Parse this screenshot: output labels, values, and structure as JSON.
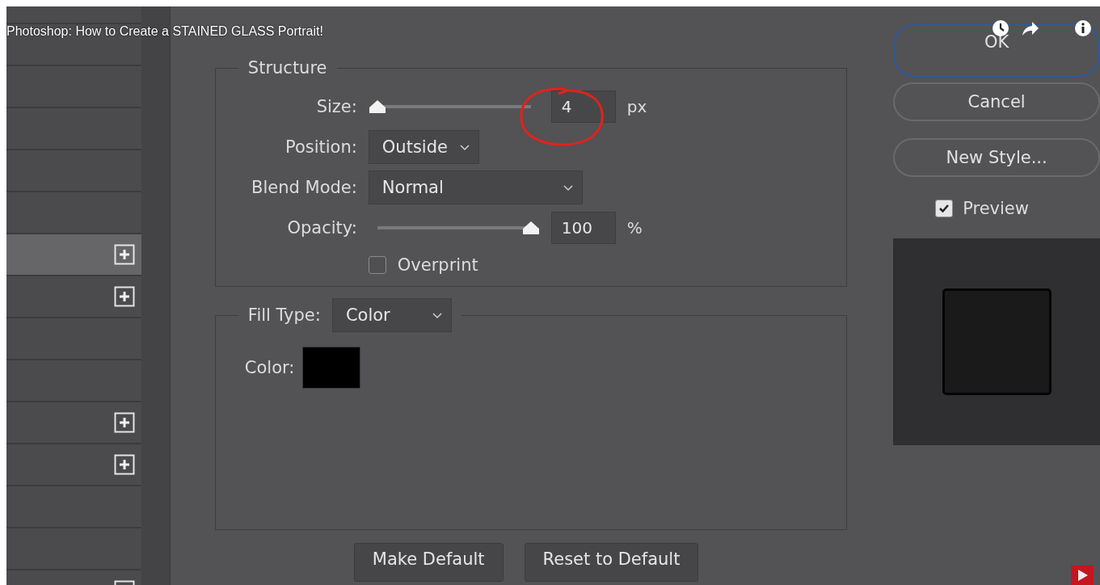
{
  "video_title": "Photoshop: How to Create a STAINED GLASS Portrait!",
  "layer_list": {
    "rows": [
      {
        "expandable": false,
        "selected": false
      },
      {
        "expandable": false,
        "selected": false
      },
      {
        "expandable": false,
        "selected": false
      },
      {
        "expandable": false,
        "selected": false
      },
      {
        "expandable": false,
        "selected": false
      },
      {
        "expandable": false,
        "selected": false
      },
      {
        "expandable": true,
        "selected": true
      },
      {
        "expandable": true,
        "selected": false
      },
      {
        "expandable": false,
        "selected": false
      },
      {
        "expandable": false,
        "selected": false
      },
      {
        "expandable": true,
        "selected": false
      },
      {
        "expandable": true,
        "selected": false
      },
      {
        "expandable": false,
        "selected": false
      },
      {
        "expandable": false,
        "selected": false
      },
      {
        "expandable": true,
        "selected": false
      }
    ]
  },
  "dialog": {
    "structure": {
      "title": "Structure",
      "size": {
        "label": "Size:",
        "level": 0.0,
        "value": "4",
        "unit": "px",
        "circled": true
      },
      "position": {
        "label": "Position:",
        "value": "Outside"
      },
      "blend_mode": {
        "label": "Blend Mode:",
        "value": "Normal"
      },
      "opacity": {
        "label": "Opacity:",
        "level": 1.0,
        "value": "100",
        "unit": "%"
      },
      "overprint": {
        "label": "Overprint",
        "checked": false
      }
    },
    "fill": {
      "label": "Fill Type:",
      "value": "Color",
      "color_label": "Color:"
    },
    "bottom_buttons": [
      "Make Default",
      "Reset to Default"
    ],
    "side_buttons": [
      {
        "label": "OK",
        "selected": true
      },
      {
        "label": "Cancel",
        "selected": false
      },
      {
        "label": "New Style...",
        "selected": false
      }
    ],
    "preview": {
      "label": "Preview",
      "checked": true
    }
  }
}
